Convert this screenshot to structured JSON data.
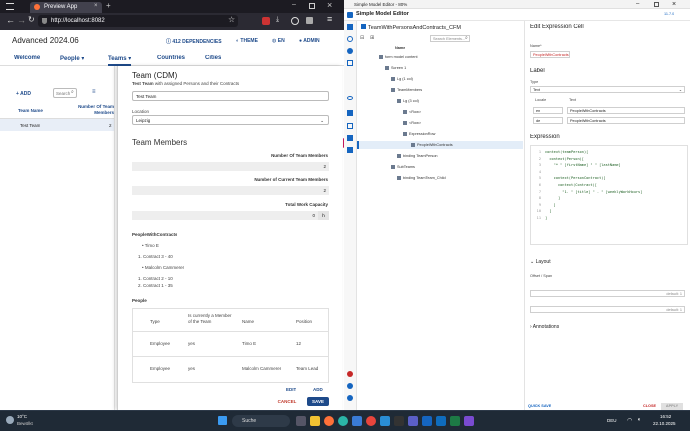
{
  "browser": {
    "tab_title": "Preview App",
    "url": "http://localhost:8082",
    "app_title": "Advanced 2024.06",
    "header_buttons": {
      "dependencies": "412 DEPENDENCIES",
      "theme": "THEME",
      "lang": "EN",
      "admin": "ADMIN"
    },
    "nav": [
      "Welcome",
      "People",
      "Teams",
      "Countries",
      "Cities"
    ],
    "add_label": "ADD",
    "search_placeholder": "Search",
    "table_headers": [
      "Team Name",
      "Number Of Team Members"
    ],
    "table_rows": [
      {
        "name": "Test Team",
        "count": "2"
      }
    ]
  },
  "dialog": {
    "title": "Team (CDM)",
    "subtitle_bold": "Test Team",
    "subtitle_rest": "with assigned Persons and their Contracts",
    "name_value": "Test Team",
    "location_label": "Location",
    "location_value": "Leipzig",
    "section_title": "Team Members",
    "num_members_label": "Number Of Team Members",
    "num_members_value": "2",
    "num_current_label": "Number of Current Team Members",
    "num_current_value": "2",
    "capacity_label": "Total Work Capacity",
    "capacity_value": "0",
    "capacity_unit": "h",
    "pwc_title": "PeopleWithContracts",
    "pwc_person1": "Timo E",
    "pwc_contract1": "1. Contract 3 - 40",
    "pwc_person2": "Malcolm Cammerer",
    "pwc_contract2a": "1. Contract 2 - 10",
    "pwc_contract2b": "2. Contract 1 - 35",
    "people_title": "People",
    "people_headers": [
      "Type",
      "Is currently a Member of the Team",
      "Name",
      "Position"
    ],
    "people_rows": [
      {
        "type": "Employee",
        "member": "yes",
        "name": "Timo E",
        "position": "12"
      },
      {
        "type": "Employee",
        "member": "yes",
        "name": "Malcolm Cammerer",
        "position": "Team Lead"
      }
    ],
    "edit_label": "EDIT",
    "add_label": "ADD",
    "cancel_label": "CANCEL",
    "save_label": "SAVE"
  },
  "editor": {
    "window_title": "Simple Model Editor - 80%",
    "app_name": "Simple Model Editor",
    "file_name": "TeamWithPersonsAndContracts_CFM",
    "search_placeholder": "Search Elements...",
    "column_name": "Name",
    "zoom": "11.7.0",
    "tree": [
      {
        "label": "form model content",
        "indent": 0
      },
      {
        "label": "Screen 1",
        "indent": 1
      },
      {
        "label": "Lg (1 col)",
        "indent": 2
      },
      {
        "label": "TeamMembers",
        "indent": 2
      },
      {
        "label": "Lg (3 col)",
        "indent": 3
      },
      {
        "label": "<Row>",
        "indent": 4
      },
      {
        "label": "<Row>",
        "indent": 4
      },
      {
        "label": "ExpressionRow",
        "indent": 4
      },
      {
        "label": "PeopleWithContracts",
        "indent": 5
      },
      {
        "label": "binding TeamPerson",
        "indent": 3
      },
      {
        "label": "SubTeams",
        "indent": 2
      },
      {
        "label": "binding TeamTeam_Child",
        "indent": 3
      }
    ],
    "prop_title": "Edit Expression Cell",
    "name_label": "Name*",
    "name_value": "PeopleWithContracts",
    "label_title": "Label",
    "type_label": "Type",
    "type_value": "Text",
    "label_col_locale": "Locale",
    "label_col_text": "Text",
    "label_rows": [
      {
        "locale": "en",
        "text": "PeopleWithContracts"
      },
      {
        "locale": "de",
        "text": "PeopleWithContracts"
      }
    ],
    "expression_title": "Expression",
    "code_lines": [
      {
        "n": "1",
        "code": "context(teamPerson)["
      },
      {
        "n": "2",
        "code": "  context(Person)["
      },
      {
        "n": "3",
        "code": "    \"* \" [firstName] \" \" [lastName]"
      },
      {
        "n": "4",
        "code": ""
      },
      {
        "n": "5",
        "code": "    context(PersonContract)["
      },
      {
        "n": "6",
        "code": "      context(Contract)["
      },
      {
        "n": "7",
        "code": "        \"1. \" [title] \" - \" [weeklyWorkHours]"
      },
      {
        "n": "8",
        "code": "      ]"
      },
      {
        "n": "9",
        "code": "    ]"
      },
      {
        "n": "10",
        "code": "  ]"
      },
      {
        "n": "11",
        "code": "]"
      }
    ],
    "layout_title": "Layout",
    "offset_label": "Offset / Span",
    "default_1": "default: 1",
    "default_2": "default: 1",
    "annotations_title": "Annotations",
    "quicksave_label": "QUICK SAVE",
    "close_label": "CLOSE",
    "apply_label": "APPLY"
  },
  "taskbar": {
    "temp": "10°C",
    "weather": "Bewölkt",
    "search": "Suche",
    "lang": "DEU",
    "time": "16:52",
    "date": "22.10.2025"
  }
}
